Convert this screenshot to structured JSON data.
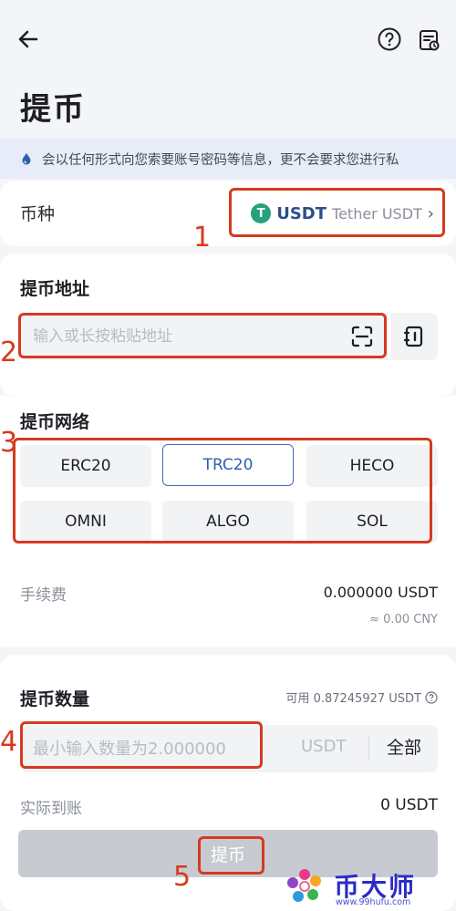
{
  "header": {
    "back_icon": "arrow-left-icon",
    "help_icon": "question-circle-icon",
    "records_icon": "records-icon"
  },
  "page_title": "提币",
  "notice": {
    "icon": "drop-icon",
    "text": "会以任何形式向您索要账号密码等信息，更不会要求您进行私"
  },
  "coin": {
    "label": "币种",
    "symbol": "USDT",
    "name": "Tether USDT",
    "logo_glyph": "T",
    "logo_color": "#26a17b",
    "chevron": "›"
  },
  "address": {
    "label": "提币地址",
    "placeholder": "输入或长按粘贴地址",
    "scan_icon": "scan-icon",
    "book_icon": "address-book-icon"
  },
  "network": {
    "label": "提币网络",
    "options": [
      "ERC20",
      "TRC20",
      "HECO",
      "OMNI",
      "ALGO",
      "SOL"
    ],
    "selected": "TRC20",
    "accent": "#3f6db5"
  },
  "fee": {
    "label": "手续费",
    "value": "0.000000 USDT",
    "cny": "≈ 0.00 CNY"
  },
  "amount": {
    "label": "提币数量",
    "available": "可用 0.87245927 USDT",
    "placeholder": "最小输入数量为2.000000",
    "unit": "USDT",
    "all_label": "全部"
  },
  "received": {
    "label": "实际到账",
    "value": "0 USDT"
  },
  "submit_label": "提币",
  "annotations": [
    "1",
    "2",
    "3",
    "4",
    "5"
  ],
  "annotation_color": "#d63a1f",
  "watermark": {
    "title": "币大师",
    "url": "www.99hufu.com"
  }
}
